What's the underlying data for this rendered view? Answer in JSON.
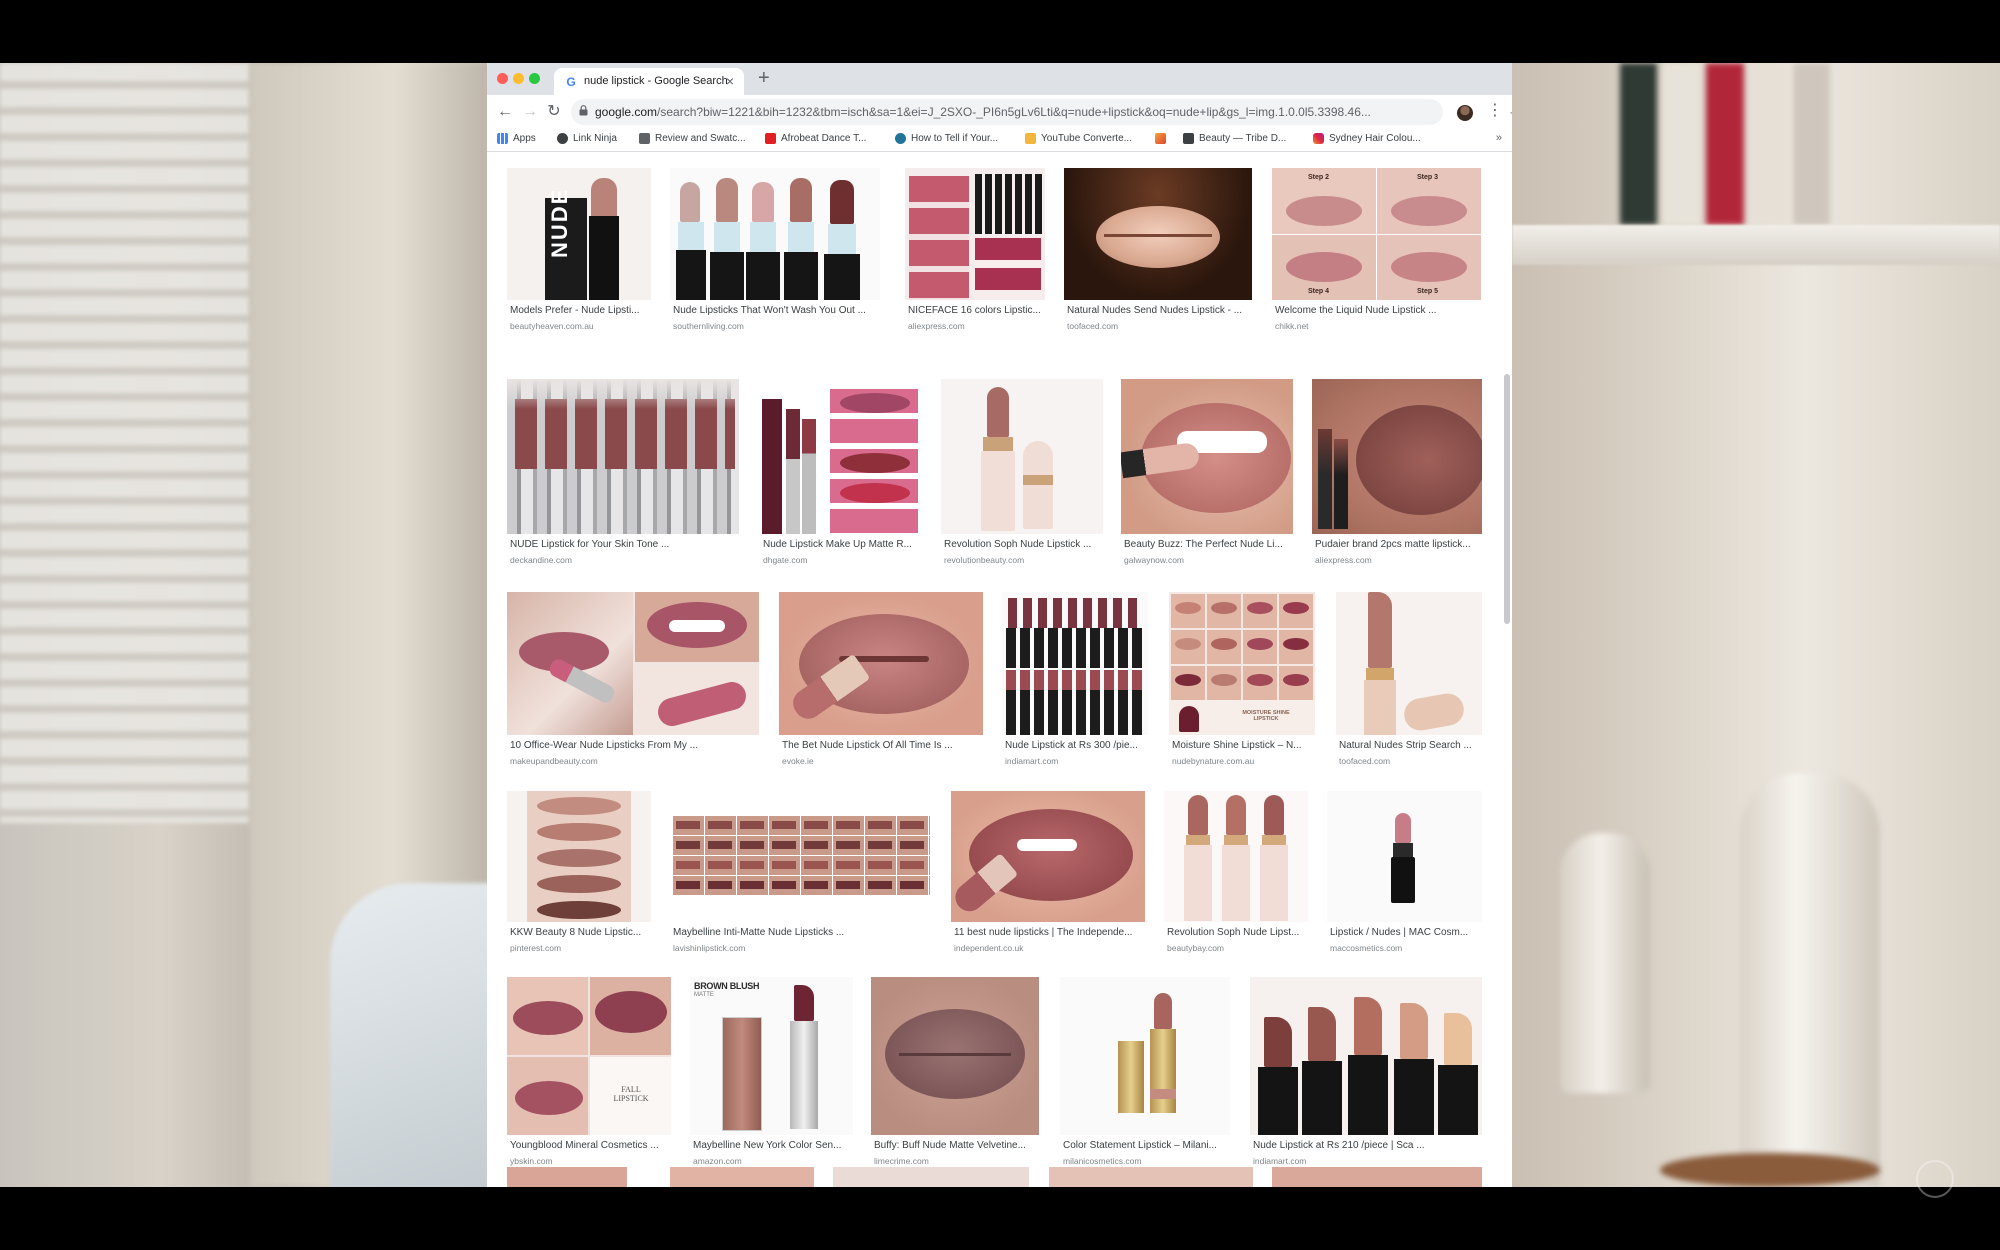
{
  "browser": {
    "tab_title": "nude lipstick - Google Search",
    "tab_favicon": "G",
    "url_host": "google.com",
    "url_rest": "/search?biw=1221&bih=1232&tbm=isch&sa=1&ei=J_2SXO-_PI6n5gLv6Lti&q=nude+lipstick&oq=nude+lip&gs_l=img.1.0.0l5.3398.46...",
    "icons": {
      "back": "back-arrow-icon",
      "forward": "forward-arrow-icon",
      "reload": "reload-icon",
      "bookmark_star": "star-icon",
      "menu": "three-dot-menu-icon"
    }
  },
  "bookmarks": [
    {
      "label": "Apps",
      "icon": "apps-grid-icon"
    },
    {
      "label": "Link Ninja",
      "icon": "globe-icon"
    },
    {
      "label": "Review and Swatc...",
      "icon": "link-icon"
    },
    {
      "label": "Afrobeat Dance T...",
      "icon": "youtube-icon"
    },
    {
      "label": "How to Tell if Your...",
      "icon": "wordpress-icon"
    },
    {
      "label": "YouTube Converte...",
      "icon": "folder-icon"
    },
    {
      "label": "",
      "icon": "bookmark-icon"
    },
    {
      "label": "Beauty — Tribe D...",
      "icon": "cursor-icon"
    },
    {
      "label": "Sydney Hair Colou...",
      "icon": "instagram-icon"
    }
  ],
  "results": [
    {
      "title": "Models Prefer - Nude Lipsti...",
      "source": "beautyheaven.com.au"
    },
    {
      "title": "Nude Lipsticks That Won't Wash You Out ...",
      "source": "southernliving.com"
    },
    {
      "title": "NICEFACE 16 colors Lipstic...",
      "source": "aliexpress.com"
    },
    {
      "title": "Natural Nudes Send Nudes Lipstick - ...",
      "source": "toofaced.com"
    },
    {
      "title": "Welcome the Liquid Nude Lipstick ...",
      "source": "chikk.net"
    },
    {
      "title": "NUDE Lipstick for Your Skin Tone ...",
      "source": "deckandine.com"
    },
    {
      "title": "Nude Lipstick Make Up Matte R...",
      "source": "dhgate.com"
    },
    {
      "title": "Revolution Soph Nude Lipstick ...",
      "source": "revolutionbeauty.com"
    },
    {
      "title": "Beauty Buzz: The Perfect Nude Li...",
      "source": "galwaynow.com"
    },
    {
      "title": "Pudaier brand 2pcs matte lipstick...",
      "source": "aliexpress.com"
    },
    {
      "title": "10 Office-Wear Nude Lipsticks From My ...",
      "source": "makeupandbeauty.com"
    },
    {
      "title": "The Bet Nude Lipstick Of All Time Is ...",
      "source": "evoke.ie"
    },
    {
      "title": "Nude Lipstick at Rs 300 /pie...",
      "source": "indiamart.com"
    },
    {
      "title": "Moisture Shine Lipstick – N...",
      "source": "nudebynature.com.au"
    },
    {
      "title": "Natural Nudes Strip Search ...",
      "source": "toofaced.com"
    },
    {
      "title": "KKW Beauty 8 Nude Lipstic...",
      "source": "pinterest.com"
    },
    {
      "title": "Maybelline Inti-Matte Nude Lipsticks ...",
      "source": "lavishinlipstick.com"
    },
    {
      "title": "11 best nude lipsticks | The Independe...",
      "source": "independent.co.uk"
    },
    {
      "title": "Revolution Soph Nude Lipst...",
      "source": "beautybay.com"
    },
    {
      "title": "Lipstick / Nudes | MAC Cosm...",
      "source": "maccosmetics.com"
    },
    {
      "title": "Youngblood Mineral Cosmetics ...",
      "source": "ybskin.com"
    },
    {
      "title": "Maybelline New York Color Sen...",
      "source": "amazon.com"
    },
    {
      "title": "Buffy: Buff Nude Matte Velvetine...",
      "source": "limecrime.com"
    },
    {
      "title": "Color Statement Lipstick – Milani...",
      "source": "milanicosmetics.com"
    },
    {
      "title": "Nude Lipstick at Rs 210 /piece | Sca ...",
      "source": "indiamart.com"
    }
  ],
  "thumb_text": {
    "nude_box": "NUDE",
    "step2": "Step 2",
    "step3": "Step 3",
    "step4": "Step 4",
    "step5": "Step 5",
    "moisture_shine": "MOISTURE SHINE LIPSTICK",
    "fall_lipstick": "FALL LIPSTICK",
    "brown_blush": "BROWN BLUSH",
    "matte": "MATTE"
  }
}
